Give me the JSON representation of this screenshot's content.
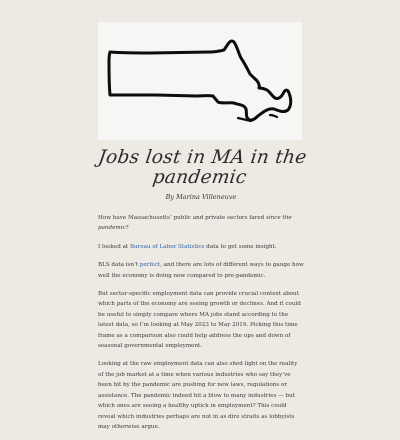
{
  "hero": {
    "image_alt": "Outline map of Massachusetts",
    "icon": "massachusetts-map-outline"
  },
  "article": {
    "title_line1": "Jobs lost in MA in the",
    "title_line2": "pandemic",
    "byline": "By Marina Villeneuve",
    "p1_text": "How have Massachusetts’ public and private sectors fared ",
    "p1_em": "since the pandemic",
    "p1_end": "?",
    "p2_start": "I looked at ",
    "p2_link": "Bureau of Labor Statistics",
    "p2_end": " data to get some insight.",
    "p3_start": "BLS data isn’t ",
    "p3_link": "perfect",
    "p3_end": ", and there are lots of different ways to gauge how well the economy is doing now compared to pre-pandemic.",
    "p4": "But sector-specific employment data can provide crucial context about which parts of the economy are seeing growth or declines. And it could be useful to simply compare where MA jobs stand according to the latest data, so I’m looking at May 2023 to May 2019. Picking this time frame as a comparison also could help address the ups and down of seasonal governmental employment.",
    "p5": "Looking at the raw employment data can also shed light on the reality of the job market at a time when various industries who say they’ve been hit by the pandemic are pushing for new laws, regulations or assistance. The pandemic indeed hit a blow to many industries — but which ones are seeing a healthy uptick in employment? This could reveal which industries perhaps are not in as dire straits as lobbyists may otherwise argue."
  },
  "colors": {
    "background": "#ede9e3",
    "hero_bg": "#f6f6f5",
    "link": "#2a67b0",
    "text": "#3a3a3a"
  }
}
